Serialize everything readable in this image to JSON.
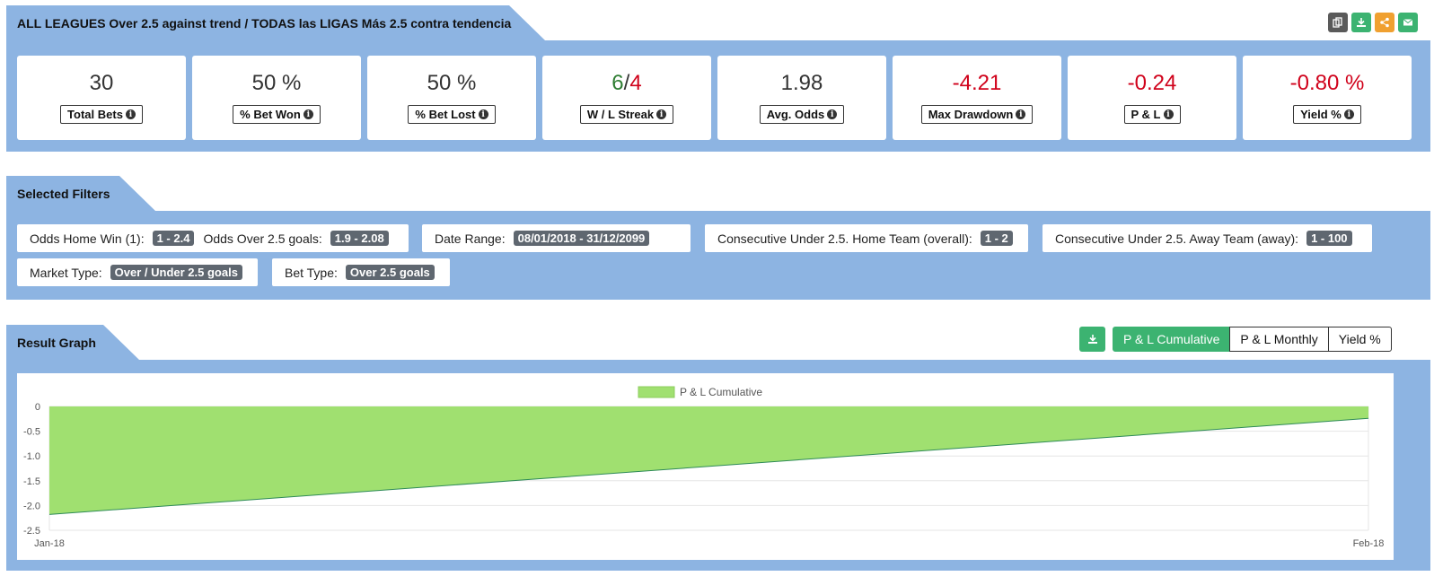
{
  "header": {
    "title": "ALL LEAGUES Over 2.5 against trend / TODAS las LIGAS Más 2.5 contra tendencia",
    "icons": [
      {
        "name": "copy-icon",
        "color": "#5a5a5a"
      },
      {
        "name": "download-icon",
        "color": "#3cb371"
      },
      {
        "name": "share-icon",
        "color": "#f0a030"
      },
      {
        "name": "email-icon",
        "color": "#3cb371"
      }
    ]
  },
  "stats": [
    {
      "value": "30",
      "label": "Total Bets"
    },
    {
      "value": "50 %",
      "label": "% Bet Won"
    },
    {
      "value": "50 %",
      "label": "% Bet Lost"
    },
    {
      "win": "6",
      "sep": "/",
      "loss": "4",
      "label": "W / L Streak"
    },
    {
      "value": "1.98",
      "label": "Avg. Odds"
    },
    {
      "value": "-4.21",
      "label": "Max Drawdown"
    },
    {
      "value": "-0.24",
      "label": "P & L"
    },
    {
      "value": "-0.80 %",
      "label": "Yield %"
    }
  ],
  "filters": {
    "title": "Selected Filters",
    "items": [
      {
        "label1": "Odds Home Win (1):",
        "value1": "1 - 2.4",
        "label2": "Odds Over 2.5 goals:",
        "value2": "1.9 - 2.08"
      },
      {
        "label": "Date Range:",
        "value": "08/01/2018 - 31/12/2099"
      },
      {
        "label": "Consecutive Under 2.5. Home Team (overall):",
        "value": "1 - 2"
      },
      {
        "label": "Consecutive Under 2.5. Away Team (away):",
        "value": "1 - 100"
      },
      {
        "label": "Market Type:",
        "value": "Over / Under 2.5 goals"
      },
      {
        "label": "Bet Type:",
        "value": "Over 2.5 goals"
      }
    ]
  },
  "graph": {
    "title": "Result Graph",
    "tabs": [
      "P & L Cumulative",
      "P & L Monthly",
      "Yield %"
    ],
    "active_tab": "P & L Cumulative"
  },
  "chart_data": {
    "type": "area",
    "x": [
      "Jan-18",
      "Feb-18"
    ],
    "series": [
      {
        "name": "P & L Cumulative",
        "values": [
          -2.18,
          -0.24
        ]
      }
    ],
    "ylim": [
      -2.5,
      0
    ],
    "yticks": [
      "0",
      "-0.5",
      "-1.0",
      "-1.5",
      "-2.0",
      "-2.5"
    ],
    "xticks": [
      "Jan-18",
      "Feb-18"
    ],
    "fill_color": "#a0e070",
    "line_color": "#2e8b57",
    "legend_position": "top"
  }
}
